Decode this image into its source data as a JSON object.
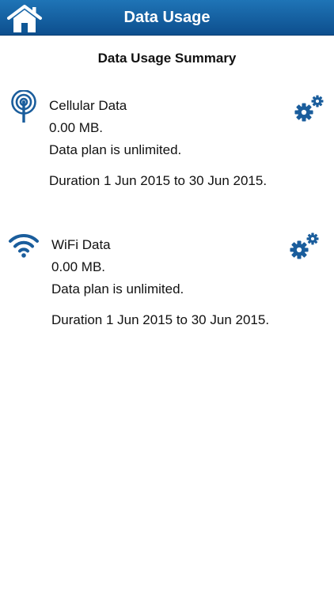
{
  "header": {
    "title": "Data Usage",
    "home_icon": "home-icon"
  },
  "summary": {
    "title": "Data Usage Summary"
  },
  "cellular": {
    "icon": "cell-tower-icon",
    "name": "Cellular Data",
    "amount": "0.00 MB.",
    "plan": "Data plan is unlimited.",
    "duration": "Duration 1 Jun 2015 to 30 Jun 2015.",
    "settings_icon": "gears-icon"
  },
  "wifi": {
    "icon": "wifi-icon",
    "name": "WiFi Data",
    "amount": "0.00 MB.",
    "plan": "Data plan is unlimited.",
    "duration": "Duration 1 Jun 2015 to 30 Jun 2015.",
    "settings_icon": "gears-icon"
  },
  "colors": {
    "header_top": "#1f74b6",
    "header_bottom": "#0d4f8e",
    "icon_blue": "#1a5d9c",
    "text": "#111111",
    "background": "#ffffff"
  }
}
